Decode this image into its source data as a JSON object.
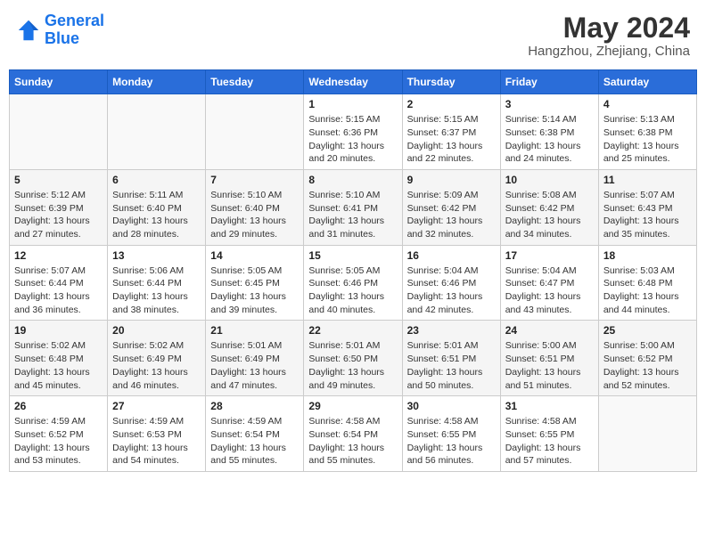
{
  "header": {
    "logo_line1": "General",
    "logo_line2": "Blue",
    "month": "May 2024",
    "location": "Hangzhou, Zhejiang, China"
  },
  "weekdays": [
    "Sunday",
    "Monday",
    "Tuesday",
    "Wednesday",
    "Thursday",
    "Friday",
    "Saturday"
  ],
  "weeks": [
    [
      {
        "day": "",
        "info": ""
      },
      {
        "day": "",
        "info": ""
      },
      {
        "day": "",
        "info": ""
      },
      {
        "day": "1",
        "info": "Sunrise: 5:15 AM\nSunset: 6:36 PM\nDaylight: 13 hours\nand 20 minutes."
      },
      {
        "day": "2",
        "info": "Sunrise: 5:15 AM\nSunset: 6:37 PM\nDaylight: 13 hours\nand 22 minutes."
      },
      {
        "day": "3",
        "info": "Sunrise: 5:14 AM\nSunset: 6:38 PM\nDaylight: 13 hours\nand 24 minutes."
      },
      {
        "day": "4",
        "info": "Sunrise: 5:13 AM\nSunset: 6:38 PM\nDaylight: 13 hours\nand 25 minutes."
      }
    ],
    [
      {
        "day": "5",
        "info": "Sunrise: 5:12 AM\nSunset: 6:39 PM\nDaylight: 13 hours\nand 27 minutes."
      },
      {
        "day": "6",
        "info": "Sunrise: 5:11 AM\nSunset: 6:40 PM\nDaylight: 13 hours\nand 28 minutes."
      },
      {
        "day": "7",
        "info": "Sunrise: 5:10 AM\nSunset: 6:40 PM\nDaylight: 13 hours\nand 29 minutes."
      },
      {
        "day": "8",
        "info": "Sunrise: 5:10 AM\nSunset: 6:41 PM\nDaylight: 13 hours\nand 31 minutes."
      },
      {
        "day": "9",
        "info": "Sunrise: 5:09 AM\nSunset: 6:42 PM\nDaylight: 13 hours\nand 32 minutes."
      },
      {
        "day": "10",
        "info": "Sunrise: 5:08 AM\nSunset: 6:42 PM\nDaylight: 13 hours\nand 34 minutes."
      },
      {
        "day": "11",
        "info": "Sunrise: 5:07 AM\nSunset: 6:43 PM\nDaylight: 13 hours\nand 35 minutes."
      }
    ],
    [
      {
        "day": "12",
        "info": "Sunrise: 5:07 AM\nSunset: 6:44 PM\nDaylight: 13 hours\nand 36 minutes."
      },
      {
        "day": "13",
        "info": "Sunrise: 5:06 AM\nSunset: 6:44 PM\nDaylight: 13 hours\nand 38 minutes."
      },
      {
        "day": "14",
        "info": "Sunrise: 5:05 AM\nSunset: 6:45 PM\nDaylight: 13 hours\nand 39 minutes."
      },
      {
        "day": "15",
        "info": "Sunrise: 5:05 AM\nSunset: 6:46 PM\nDaylight: 13 hours\nand 40 minutes."
      },
      {
        "day": "16",
        "info": "Sunrise: 5:04 AM\nSunset: 6:46 PM\nDaylight: 13 hours\nand 42 minutes."
      },
      {
        "day": "17",
        "info": "Sunrise: 5:04 AM\nSunset: 6:47 PM\nDaylight: 13 hours\nand 43 minutes."
      },
      {
        "day": "18",
        "info": "Sunrise: 5:03 AM\nSunset: 6:48 PM\nDaylight: 13 hours\nand 44 minutes."
      }
    ],
    [
      {
        "day": "19",
        "info": "Sunrise: 5:02 AM\nSunset: 6:48 PM\nDaylight: 13 hours\nand 45 minutes."
      },
      {
        "day": "20",
        "info": "Sunrise: 5:02 AM\nSunset: 6:49 PM\nDaylight: 13 hours\nand 46 minutes."
      },
      {
        "day": "21",
        "info": "Sunrise: 5:01 AM\nSunset: 6:49 PM\nDaylight: 13 hours\nand 47 minutes."
      },
      {
        "day": "22",
        "info": "Sunrise: 5:01 AM\nSunset: 6:50 PM\nDaylight: 13 hours\nand 49 minutes."
      },
      {
        "day": "23",
        "info": "Sunrise: 5:01 AM\nSunset: 6:51 PM\nDaylight: 13 hours\nand 50 minutes."
      },
      {
        "day": "24",
        "info": "Sunrise: 5:00 AM\nSunset: 6:51 PM\nDaylight: 13 hours\nand 51 minutes."
      },
      {
        "day": "25",
        "info": "Sunrise: 5:00 AM\nSunset: 6:52 PM\nDaylight: 13 hours\nand 52 minutes."
      }
    ],
    [
      {
        "day": "26",
        "info": "Sunrise: 4:59 AM\nSunset: 6:52 PM\nDaylight: 13 hours\nand 53 minutes."
      },
      {
        "day": "27",
        "info": "Sunrise: 4:59 AM\nSunset: 6:53 PM\nDaylight: 13 hours\nand 54 minutes."
      },
      {
        "day": "28",
        "info": "Sunrise: 4:59 AM\nSunset: 6:54 PM\nDaylight: 13 hours\nand 55 minutes."
      },
      {
        "day": "29",
        "info": "Sunrise: 4:58 AM\nSunset: 6:54 PM\nDaylight: 13 hours\nand 55 minutes."
      },
      {
        "day": "30",
        "info": "Sunrise: 4:58 AM\nSunset: 6:55 PM\nDaylight: 13 hours\nand 56 minutes."
      },
      {
        "day": "31",
        "info": "Sunrise: 4:58 AM\nSunset: 6:55 PM\nDaylight: 13 hours\nand 57 minutes."
      },
      {
        "day": "",
        "info": ""
      }
    ]
  ]
}
